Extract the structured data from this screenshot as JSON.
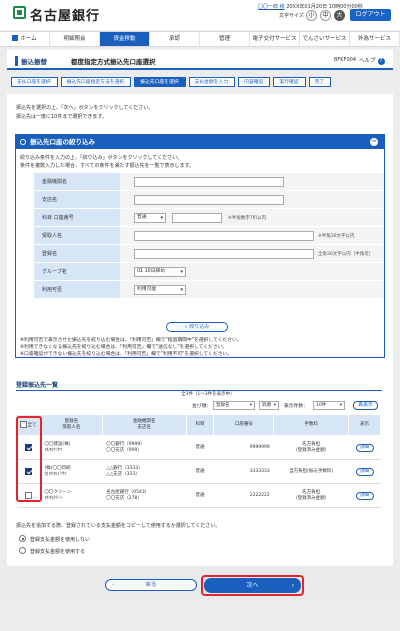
{
  "header": {
    "bank_name": "名古屋銀行",
    "user_name": "〇〇一郎 様",
    "login_time": "20XX年01月20日 10時00分00秒",
    "font_size_label": "文字サイズ",
    "font_small": "小",
    "font_medium": "中",
    "font_large": "大",
    "logout_label": "ログアウト"
  },
  "nav": [
    {
      "label": "ホーム"
    },
    {
      "label": "明細照会"
    },
    {
      "label": "資金移動"
    },
    {
      "label": "承認"
    },
    {
      "label": "管理"
    },
    {
      "label": "電子交付サービス"
    },
    {
      "label": "でんさいサービス"
    },
    {
      "label": "外為サービス"
    }
  ],
  "title": {
    "category": "振込振替",
    "page_title": "都度指定方式振込先口座選択",
    "screen_code": "BFKF004",
    "help_label": "ヘルプ"
  },
  "steps": [
    {
      "label": "支払口座を選択"
    },
    {
      "label": "振込先口座指定方法を選択"
    },
    {
      "label": "振込先口座を選択"
    },
    {
      "label": "支払金額を入力"
    },
    {
      "label": "内容確認"
    },
    {
      "label": "実行確認"
    },
    {
      "label": "完了"
    }
  ],
  "intro": {
    "line1": "振込先を選択の上、「次へ」ボタンをクリックしてください。",
    "line2": "振込先は一度に10件まで選択できます。"
  },
  "filter": {
    "heading": "振込先口座の絞り込み",
    "note1": "絞り込み条件を入力の上、「絞り込み」ボタンをクリックしてください。",
    "note2": "条件を複数入力した場合、すべての条件を満たす振込先を一覧で表示します。",
    "fields": {
      "bank_label": "金融機関名",
      "branch_label": "支店名",
      "account_label": "科目 口座番号",
      "account_type": "普通",
      "account_hint": "※半角数字7桁以内",
      "payee_label": "受取人名",
      "payee_hint": "※半角30文字以内",
      "reg_name_label": "登録名",
      "reg_name_hint": "全角30文字以内［半角可］",
      "group_label": "グループ名",
      "group_value": "01 10日締め",
      "usable_label": "利用可否",
      "usable_value": "利用可能"
    },
    "button_label": "絞り込み",
    "warn1": "※利用可否で表示させた振込先を絞り込む場合は、「利用可否」欄で\"経過期間中\"を選択してください。",
    "warn2": "※利用できなくなる振込先を絞り込む場合は、「利用可否」欄で\"送信なし\"を選択してください。",
    "warn3": "※口座確認ができない振込先を絞り込む場合は、「利用可否」欄で\"利用不可\"を選択してください。"
  },
  "list": {
    "heading": "登録振込先一覧",
    "count_text": "全3件（1～3件を表示中）",
    "sort_label": "並び順：",
    "sort_field": "登録名",
    "sort_order": "昇順",
    "per_page_label": "表示件数：",
    "per_page": "10件",
    "resort_label": "再表示",
    "columns": {
      "all": "全て",
      "reg_name": "登録名",
      "payee": "受取人名",
      "bank": "金融機関名",
      "branch": "支店名",
      "type": "科目",
      "account_no": "口座番号",
      "fee": "手数料",
      "view": "表示"
    },
    "rows": [
      {
        "reg": "〇〇建設(株)",
        "kana": "ﾏﾙﾏﾙｹﾝｾﾂ",
        "bank": "〇〇銀行（9999）",
        "branch": "〇〇支店（999）",
        "type": "普通",
        "account": "9999999",
        "fee": "先方負担",
        "fee2": "（登録済み金額）",
        "detail": "詳細",
        "checked": true
      },
      {
        "reg": "(株)〇〇印刷",
        "kana": "ｶ)ﾏﾙﾏﾙｲﾝｻﾂ",
        "bank": "△△銀行（3333）",
        "branch": "△△支店（333）",
        "type": "普通",
        "account": "3333333",
        "fee": "当方負担(振込手数料)",
        "fee2": "",
        "detail": "詳細",
        "checked": true
      },
      {
        "reg": "〇〇クリーン",
        "kana": "ﾏﾙﾏﾙｸﾘｰﾝ",
        "bank": "名古屋銀行（0543）",
        "branch": "〇〇支店（278）",
        "type": "普通",
        "account": "2222222",
        "fee": "先方負担",
        "fee2": "（登録済み金額）",
        "detail": "詳細",
        "checked": false
      }
    ]
  },
  "addition": {
    "question": "振込先を追加する際、登録されている支払金額をコピーして使用するか選択してください。",
    "opt1": "登録支払金額を使用しない",
    "opt2": "登録支払金額を使用する"
  },
  "buttons": {
    "back": "戻る",
    "next": "次へ"
  }
}
